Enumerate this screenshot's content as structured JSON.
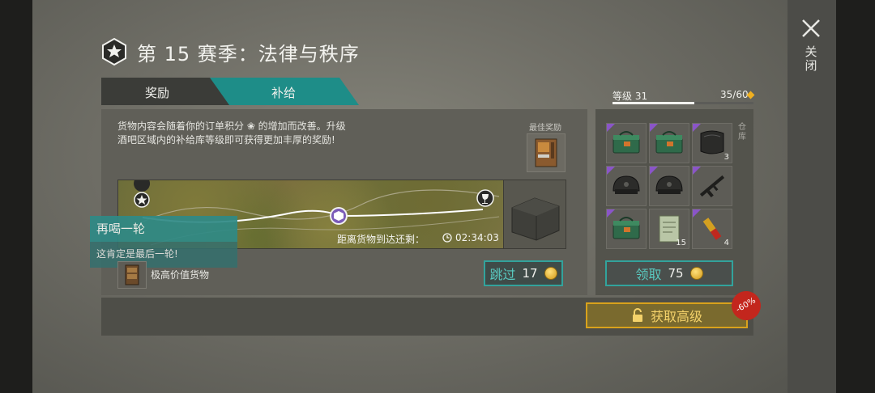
{
  "header": {
    "title": "第 15 赛季：法律与秩序",
    "close_label": "关闭"
  },
  "tabs": [
    {
      "label": "奖励",
      "active": false
    },
    {
      "label": "补给",
      "active": true
    }
  ],
  "level": {
    "label": "等级 31",
    "progress": "35/60",
    "fill_fraction": 0.58
  },
  "description": {
    "line1": "货物内容会随着你的订单积分 ❀ 的增加而改善。升级",
    "line2": "酒吧区域内的补给库等级即可获得更加丰厚的奖励!"
  },
  "best_reward_label": "最佳奖励",
  "map": {
    "arrive_label": "距离货物到达还剩：",
    "timer": "02:34:03"
  },
  "tooltip": {
    "title": "再喝一轮",
    "body": "这肯定是最后一轮!"
  },
  "high_value_label": "极高价值货物",
  "skip": {
    "label": "跳过",
    "cost": "17"
  },
  "rewards": [
    {
      "icon": "ammo-box-icon",
      "rare": true,
      "count": ""
    },
    {
      "icon": "ammo-box-icon",
      "rare": true,
      "count": ""
    },
    {
      "icon": "armor-plate-icon",
      "rare": true,
      "count": "3"
    },
    {
      "icon": "helmet-icon",
      "rare": true,
      "count": ""
    },
    {
      "icon": "helmet-icon",
      "rare": true,
      "count": ""
    },
    {
      "icon": "rifle-icon",
      "rare": true,
      "count": ""
    },
    {
      "icon": "ammo-box-icon",
      "rare": true,
      "count": ""
    },
    {
      "icon": "manual-icon",
      "rare": false,
      "count": "15"
    },
    {
      "icon": "cartridge-icon",
      "rare": true,
      "count": "4"
    }
  ],
  "warehouse_label": "仓库",
  "claim": {
    "label": "领取",
    "cost": "75"
  },
  "upgrade": {
    "label": "获取高级",
    "discount": "-60%"
  },
  "colors": {
    "teal": "#1e8d88",
    "gold": "#d9a21c",
    "rare": "#8a55c8",
    "discount": "#c3261d"
  }
}
